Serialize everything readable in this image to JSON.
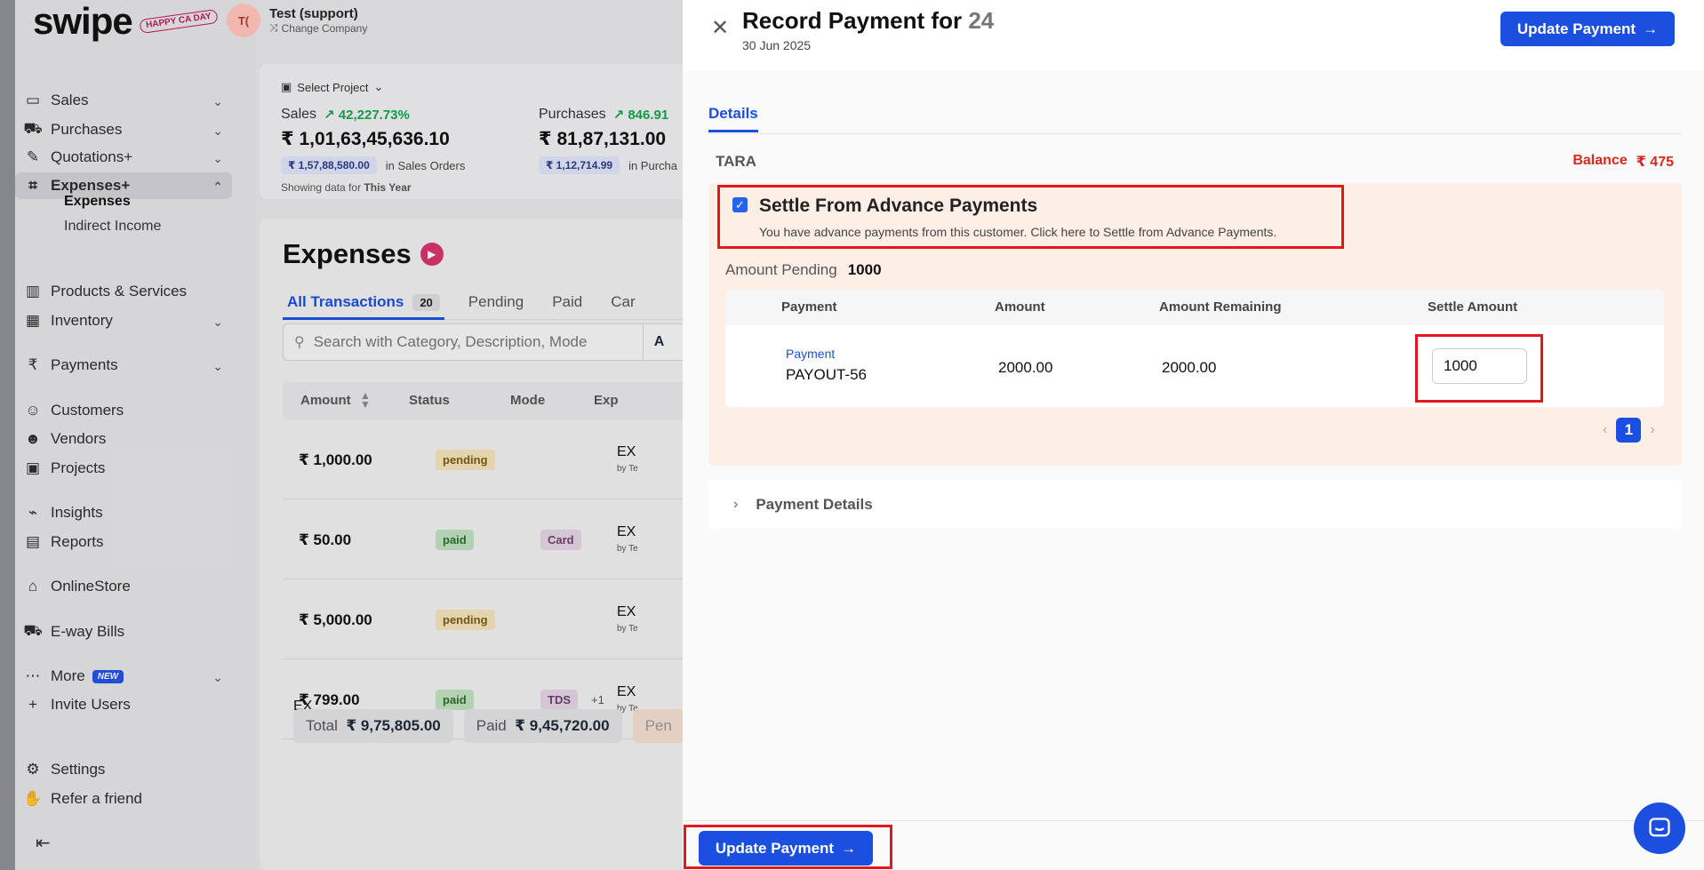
{
  "brand": {
    "logo": "swipe",
    "badge": "HAPPY CA DAY"
  },
  "company": {
    "avatar": "T(",
    "name": "Test (support)",
    "change": "Change Company"
  },
  "nav": [
    {
      "label": "Sales",
      "icon": "cash-icon",
      "chevron": true
    },
    {
      "label": "Purchases",
      "icon": "cart-icon",
      "chevron": true
    },
    {
      "label": "Quotations+",
      "icon": "pen-icon",
      "chevron": true
    },
    {
      "label": "Expenses+",
      "icon": "tag-icon",
      "chevron": true,
      "active": true
    },
    {
      "label": "Products & Services",
      "icon": "barcode-icon"
    },
    {
      "label": "Inventory",
      "icon": "warehouse-icon",
      "chevron": true
    },
    {
      "label": "Payments",
      "icon": "rupee-icon",
      "chevron": true
    },
    {
      "label": "Customers",
      "icon": "user-icon"
    },
    {
      "label": "Vendors",
      "icon": "users-icon"
    },
    {
      "label": "Projects",
      "icon": "briefcase-icon"
    },
    {
      "label": "Insights",
      "icon": "chart-icon"
    },
    {
      "label": "Reports",
      "icon": "report-icon"
    },
    {
      "label": "OnlineStore",
      "icon": "store-icon"
    },
    {
      "label": "E-way Bills",
      "icon": "truck-icon"
    },
    {
      "label": "More",
      "icon": "dots-icon",
      "chevron": true,
      "badge": "NEW"
    },
    {
      "label": "Invite Users",
      "icon": "user-plus-icon"
    },
    {
      "label": "Settings",
      "icon": "gear-icon"
    },
    {
      "label": "Refer a friend",
      "icon": "hand-icon"
    }
  ],
  "subnav": [
    "Expenses",
    "Indirect Income"
  ],
  "stats": {
    "project": "Select Project",
    "sales_label": "Sales",
    "sales_growth": "42,227.73%",
    "sales_value": "₹ 1,01,63,45,636.10",
    "sales_orders_pill": "₹ 1,57,88,580.00",
    "sales_orders_text": "in Sales Orders",
    "purchases_label": "Purchases",
    "purchases_growth": "846.91",
    "purchases_value": "₹ 81,87,131.00",
    "purchases_pill": "₹ 1,12,714.99",
    "purchases_text": "in Purcha",
    "showing_prefix": "Showing data for",
    "showing_period": "This Year"
  },
  "expenses": {
    "title": "Expenses",
    "tabs": [
      {
        "label": "All Transactions",
        "count": "20"
      },
      {
        "label": "Pending"
      },
      {
        "label": "Paid"
      },
      {
        "label": "Car"
      }
    ],
    "search_placeholder": "Search with Category, Description, Mode",
    "search_btn": "A",
    "columns": [
      "Amount",
      "Status",
      "Mode",
      "Exp"
    ],
    "rows": [
      {
        "amount": "₹ 1,000.00",
        "status": "pending",
        "mode": "",
        "extra": "",
        "exp": "EX",
        "by": "by Te"
      },
      {
        "amount": "₹ 50.00",
        "status": "paid",
        "mode": "Card",
        "extra": "",
        "exp": "EX",
        "by": "by Te"
      },
      {
        "amount": "₹ 5,000.00",
        "status": "pending",
        "mode": "",
        "extra": "",
        "exp": "EX",
        "by": "by Te"
      },
      {
        "amount": "₹ 799.00",
        "status": "paid",
        "mode": "TDS",
        "extra": "+1",
        "exp": "EX",
        "by": "by Te"
      }
    ],
    "cut_row_exp": "EX",
    "footer": {
      "total_label": "Total",
      "total_value": "₹ 9,75,805.00",
      "paid_label": "Paid",
      "paid_value": "₹ 9,45,720.00",
      "pending_label": "Pen"
    }
  },
  "drawer": {
    "title": "Record Payment for",
    "title_num": "24",
    "date": "30 Jun 2025",
    "update_btn": "Update Payment",
    "tab": "Details",
    "party": "TARA",
    "balance_label": "Balance",
    "balance_value": "₹ 475",
    "settle": {
      "title": "Settle From Advance Payments",
      "desc": "You have advance payments from this customer. Click here to Settle from Advance Payments.",
      "checked": true
    },
    "pending_label": "Amount Pending",
    "pending_value": "1000",
    "table": {
      "headers": [
        "Payment",
        "Amount",
        "Amount Remaining",
        "Settle Amount"
      ],
      "rows": [
        {
          "type": "Payment",
          "id": "PAYOUT-56",
          "amount": "2000.00",
          "remaining": "2000.00",
          "settle": "1000"
        }
      ]
    },
    "page": "1",
    "payment_details": "Payment Details",
    "footer_btn": "Update Payment"
  },
  "colors": {
    "primary": "#1b4fe0",
    "danger": "#d8281d",
    "settle_bg": "#fdefe6",
    "highlight": "#e1191e"
  }
}
